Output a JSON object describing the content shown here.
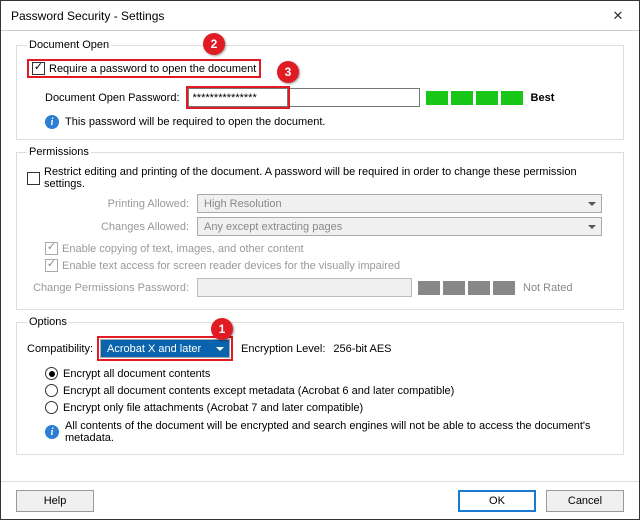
{
  "window": {
    "title": "Password Security - Settings"
  },
  "badges": {
    "b1": "1",
    "b2": "2",
    "b3": "3"
  },
  "doc_open": {
    "legend": "Document Open",
    "require_label": "Require a password to open the document",
    "pwd_label": "Document Open Password:",
    "pwd_value": "***************",
    "strength_label": "Best",
    "info": "This password will be required to open the document."
  },
  "perm": {
    "legend": "Permissions",
    "restrict_label": "Restrict editing and printing of the document. A password will be required in order to change these permission settings.",
    "printing_label": "Printing Allowed:",
    "printing_value": "High Resolution",
    "changes_label": "Changes Allowed:",
    "changes_value": "Any except extracting pages",
    "copy_label": "Enable copying of text, images, and other content",
    "access_label": "Enable text access for screen reader devices for the visually impaired",
    "pwd_label": "Change Permissions Password:",
    "strength_label": "Not Rated"
  },
  "options": {
    "legend": "Options",
    "compat_label": "Compatibility:",
    "compat_value": "Acrobat X and later",
    "enc_level_label": "Encryption Level:",
    "enc_level_value": "256-bit AES",
    "r1": "Encrypt all document contents",
    "r2": "Encrypt all document contents except metadata (Acrobat 6 and later compatible)",
    "r3": "Encrypt only file attachments (Acrobat 7 and later compatible)",
    "info": "All contents of the document will be encrypted and search engines will not be able to access the document's metadata."
  },
  "footer": {
    "help": "Help",
    "ok": "OK",
    "cancel": "Cancel"
  }
}
